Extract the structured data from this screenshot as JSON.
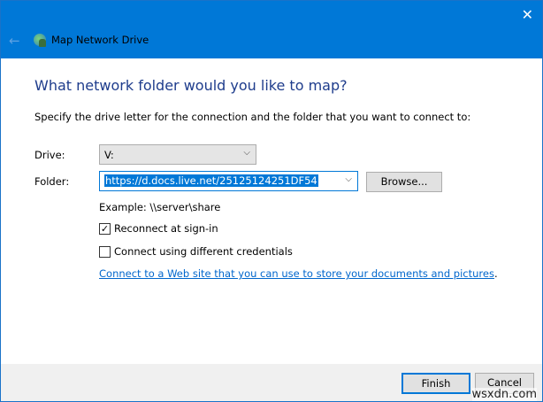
{
  "window": {
    "title": "Map Network Drive",
    "close_icon": "close-icon",
    "back_icon": "back-arrow-icon"
  },
  "heading": "What network folder would you like to map?",
  "instruction": "Specify the drive letter for the connection and the folder that you want to connect to:",
  "drive": {
    "label": "Drive:",
    "value": "V:"
  },
  "folder": {
    "label": "Folder:",
    "value": "https://d.docs.live.net/25125124251DF54"
  },
  "browse_label": "Browse...",
  "example": "Example: \\\\server\\share",
  "reconnect": {
    "label": "Reconnect at sign-in",
    "checked": true
  },
  "credentials": {
    "label": "Connect using different credentials",
    "checked": false
  },
  "link_text": "Connect to a Web site that you can use to store your documents and pictures",
  "link_suffix": ".",
  "finish_label": "Finish",
  "cancel_label": "Cancel",
  "watermark": "wsxdn.com"
}
